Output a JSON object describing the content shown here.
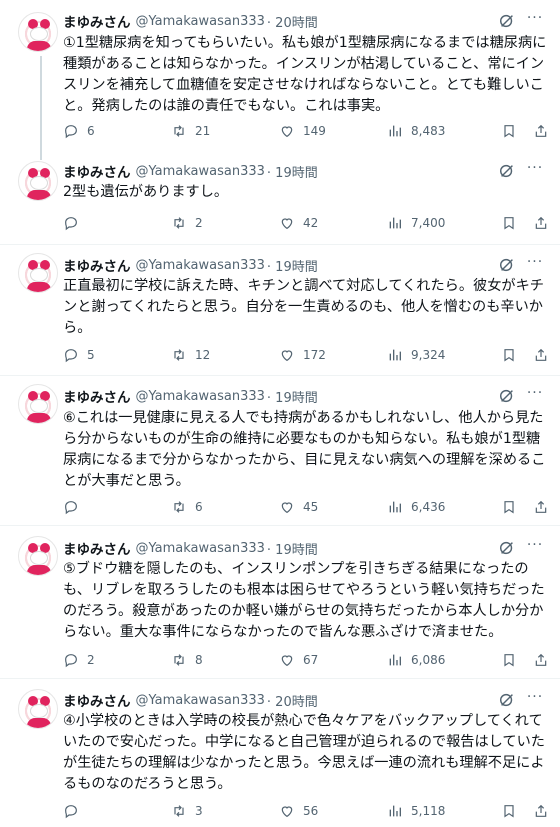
{
  "author": {
    "name": "まゆみさん",
    "handle": "@Yamakawasan333"
  },
  "tweets": [
    {
      "time": "· 20時間",
      "text": "①1型糖尿病を知ってもらいたい。私も娘が1型糖尿病になるまでは糖尿病に種類があることは知らなかった。インスリンが枯渇していること、常にインスリンを補充して血糖値を安定させなければならないこと。とても難しいこと。発病したのは誰の責任でもない。これは事実。",
      "replies": "6",
      "retweets": "21",
      "likes": "149",
      "views": "8,483"
    },
    {
      "time": "· 19時間",
      "text": "2型も遺伝がありますし。",
      "replies": "",
      "retweets": "2",
      "likes": "42",
      "views": "7,400"
    },
    {
      "time": "· 19時間",
      "text": "正直最初に学校に訴えた時、キチンと調べて対応してくれたら。彼女がキチンと謝ってくれたらと思う。自分を一生責めるのも、他人を憎むのも辛いから。",
      "replies": "5",
      "retweets": "12",
      "likes": "172",
      "views": "9,324"
    },
    {
      "time": "· 19時間",
      "text": "⑥これは一見健康に見える人でも持病があるかもしれないし、他人から見たら分からないものが生命の維持に必要なものかも知らない。私も娘が1型糖尿病になるまで分からなかったから、目に見えない病気への理解を深めることが大事だと思う。",
      "replies": "",
      "retweets": "6",
      "likes": "45",
      "views": "6,436"
    },
    {
      "time": "· 19時間",
      "text": "⑤ブドウ糖を隠したのも、インスリンポンプを引きちぎる結果になったのも、リブレを取ろうしたのも根本は困らせてやろうという軽い気持ちだったのだろう。殺意があったのか軽い嫌がらせの気持ちだったから本人しか分からない。重大な事件にならなかったので皆んな悪ふざけで済ませた。",
      "replies": "2",
      "retweets": "8",
      "likes": "67",
      "views": "6,086"
    },
    {
      "time": "· 20時間",
      "text": "④小学校のときは入学時の校長が熱心で色々ケアをバックアップしてくれていたので安心だった。中学になると自己管理が迫られるので報告はしていたが生徒たちの理解は少なかったと思う。今思えば一連の流れも理解不足によるものなのだろうと思う。",
      "replies": "",
      "retweets": "3",
      "likes": "56",
      "views": "5,118"
    }
  ],
  "icons": {
    "reply": "reply-icon",
    "retweet": "retweet-icon",
    "like": "heart-icon",
    "views": "views-icon",
    "bookmark": "bookmark-icon",
    "share": "share-icon",
    "grok": "grok-icon",
    "more": "more-icon"
  }
}
